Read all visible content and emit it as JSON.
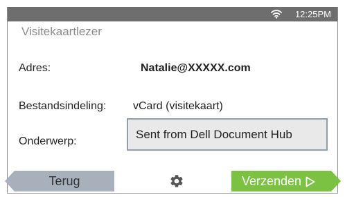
{
  "status": {
    "time": "12:25PM",
    "wifi_icon": "wifi-icon"
  },
  "app": {
    "title": "Visitekaartlezer"
  },
  "form": {
    "address_label": "Adres:",
    "address_value": "Natalie@XXXXX.com",
    "format_label": "Bestandsindeling:",
    "format_value": "vCard (visitekaart)",
    "subject_label": "Onderwerp:",
    "subject_value": "Sent from Dell Document Hub"
  },
  "footer": {
    "back_label": "Terug",
    "settings_icon": "gear-icon",
    "send_label": "Verzenden",
    "send_icon": "play-icon"
  },
  "colors": {
    "status_bar": "#6e6e6e",
    "back_button": "#a8b0bb",
    "send_button": "#7cc242",
    "subject_field_bg": "#e9e9e9",
    "subject_field_border": "#8f9fb0"
  }
}
